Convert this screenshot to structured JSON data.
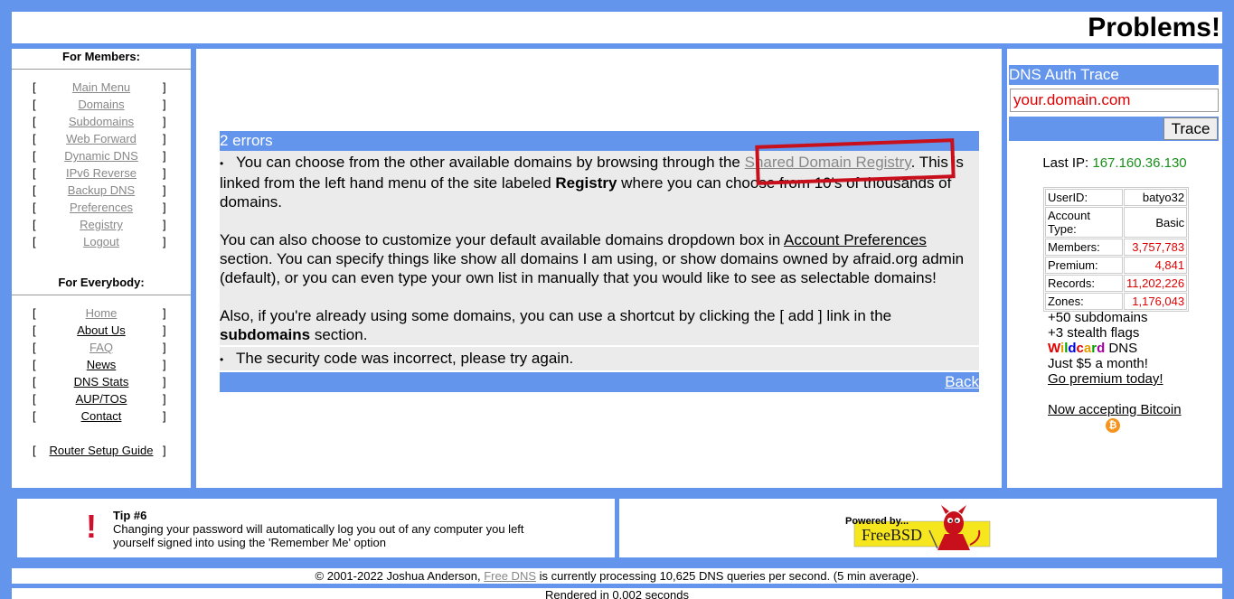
{
  "header": {
    "title": "Problems!"
  },
  "left": {
    "members_heading": "For Members:",
    "members_items": [
      {
        "label": "Main Menu"
      },
      {
        "label": "Domains"
      },
      {
        "label": "Subdomains"
      },
      {
        "label": "Web Forward"
      },
      {
        "label": "Dynamic DNS"
      },
      {
        "label": "IPv6 Reverse"
      },
      {
        "label": "Backup DNS"
      },
      {
        "label": "Preferences"
      },
      {
        "label": "Registry"
      },
      {
        "label": "Logout"
      }
    ],
    "everybody_heading": "For Everybody:",
    "everybody_items": [
      {
        "label": "Home"
      },
      {
        "label": "About Us"
      },
      {
        "label": "FAQ"
      },
      {
        "label": "News"
      },
      {
        "label": "DNS Stats"
      },
      {
        "label": "AUP/TOS"
      },
      {
        "label": "Contact"
      }
    ],
    "router_guide": "Router Setup Guide",
    "bracket_open": "[",
    "bracket_close": "]"
  },
  "errors": {
    "heading": "2 errors",
    "e1_a": "You can choose from the other available domains by browsing through the ",
    "e1_link": "Shared Domain Registry",
    "e1_b": ". This is linked from the left hand menu of the site labeled ",
    "e1_bold": "Registry",
    "e1_c": " where you can choose from 10's of thousands of domains.",
    "e1_p2a": "You can also choose to customize your default available domains dropdown box in ",
    "e1_p2link": "Account Preferences",
    "e1_p2b": " section. You can specify things like show all domains I am using, or show domains owned by afraid.org admin (default), or you can even type your own list in manually that you would like to see as selectable domains!",
    "e1_p3a": "Also, if you're already using some domains, you can use a shortcut by clicking the [ add ] link in the ",
    "e1_p3bold": "subdomains",
    "e1_p3b": " section.",
    "e2": "The security code was incorrect, please try again.",
    "back": "Back"
  },
  "trace": {
    "heading": "DNS Auth Trace",
    "value": "your.domain.com",
    "button": "Trace"
  },
  "last_ip": {
    "label": "Last IP: ",
    "value": "167.160.36.130"
  },
  "stats": [
    {
      "label": "UserID:",
      "value": "batyo32",
      "red": false
    },
    {
      "label": "Account Type:",
      "value": "Basic",
      "red": false
    },
    {
      "label": "Members:",
      "value": "3,757,783",
      "red": true
    },
    {
      "label": "Premium:",
      "value": "4,841",
      "red": true
    },
    {
      "label": "Records:",
      "value": "11,202,226",
      "red": true
    },
    {
      "label": "Zones:",
      "value": "1,176,043",
      "red": true
    }
  ],
  "promo": {
    "line1": "+50 subdomains",
    "line2": "+3 stealth flags",
    "wildcard": "Wildcard",
    "dns": " DNS",
    "line4": "Just $5 a month!",
    "link": "Go premium today!",
    "bitcoin": "Now accepting Bitcoin",
    "wildcard_colors": [
      "#e00000",
      "#e0a000",
      "#00a000",
      "#0000e0",
      "#e00000",
      "#e0a000",
      "#00a000",
      "#a000a0"
    ]
  },
  "tip": {
    "icon": "!",
    "title": "Tip #6",
    "text": "Changing your password will automatically log you out of any computer you left yourself signed into using the 'Remember Me' option"
  },
  "freebsd": {
    "powered": "Powered by...",
    "name": "FreeBSD"
  },
  "footer": {
    "copy_a": "© 2001-2022 Joshua Anderson, ",
    "copy_link": "Free DNS",
    "copy_b": " is currently processing 10,625 DNS queries per second. (5 min average).",
    "rendered": "Rendered in 0.002 seconds"
  }
}
